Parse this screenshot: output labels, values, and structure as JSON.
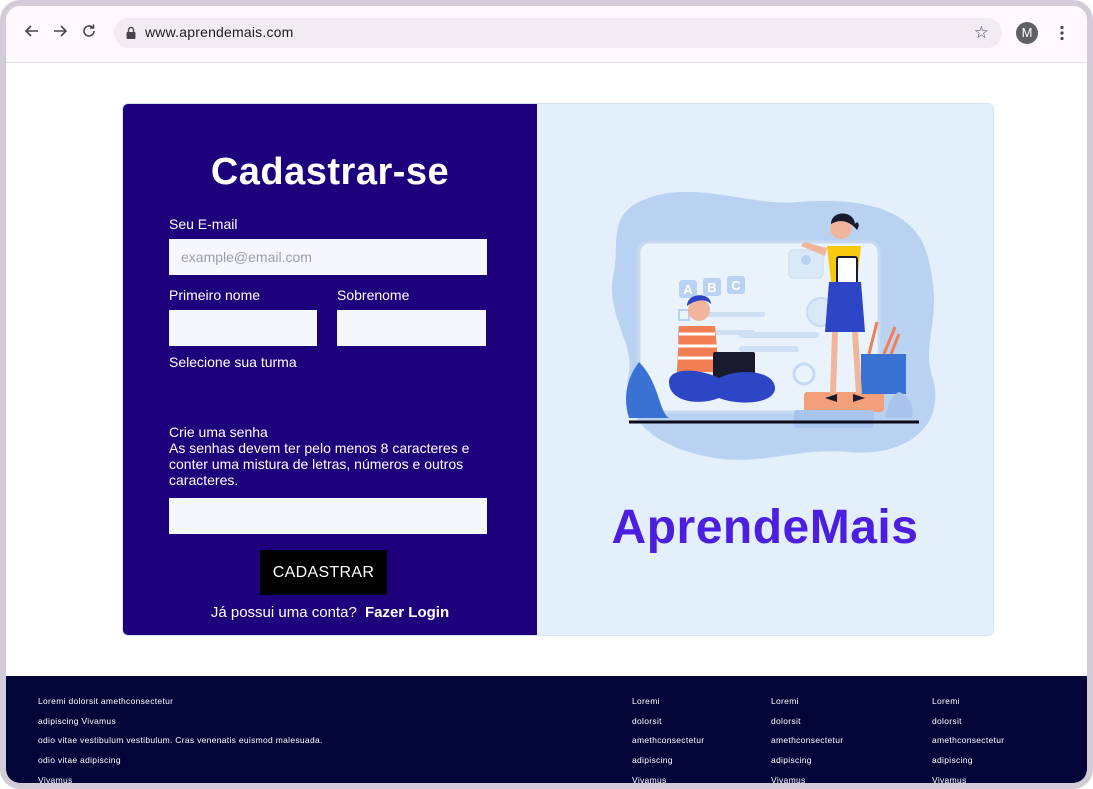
{
  "browser": {
    "url": "www.aprendemais.com",
    "avatar_letter": "M"
  },
  "signup": {
    "title": "Cadastrar-se",
    "email_label": "Seu E-mail",
    "email_placeholder": "example@email.com",
    "first_name_label": "Primeiro nome",
    "last_name_label": "Sobrenome",
    "class_label": "Selecione sua turma",
    "password_label": "Crie uma senha",
    "password_hint": "As senhas devem ter pelo menos 8 caracteres e conter uma mistura de letras, números e outros caracteres.",
    "submit_label": "CADASTRAR",
    "login_prompt": "Já possui uma conta?",
    "login_link": "Fazer Login"
  },
  "brand": {
    "name": "AprendeMais",
    "color": "#4b1ee0"
  },
  "footer": {
    "about": [
      "Loremi dolorsit amethconsectetur",
      "adipiscing Vivamus",
      "odio vitae vestibulum vestibulum. Cras venenatis euismod malesuada.",
      "odio vitae adipiscing",
      "Vivamus"
    ],
    "columns": [
      [
        "Loremi",
        "dolorsit",
        "amethconsectetur",
        "adipiscing",
        "Vivamus"
      ],
      [
        "Loremi",
        "dolorsit",
        "amethconsectetur",
        "adipiscing",
        "Vivamus"
      ],
      [
        "Loremi",
        "dolorsit",
        "amethconsectetur",
        "adipiscing",
        "Vivamus"
      ]
    ]
  },
  "icons": [
    "back-arrow-icon",
    "forward-arrow-icon",
    "reload-icon",
    "lock-icon",
    "star-icon",
    "more-vert-icon"
  ]
}
